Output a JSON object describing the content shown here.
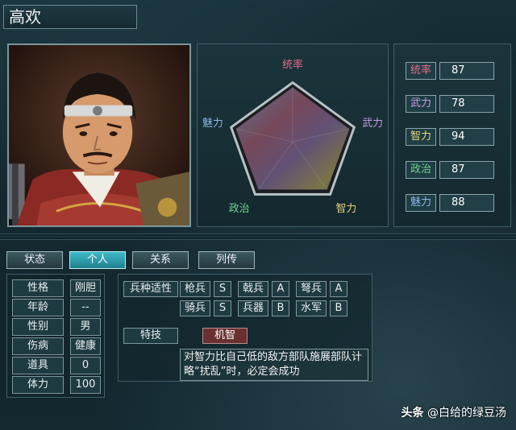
{
  "header": {
    "name": "高欢"
  },
  "radar": {
    "labels": {
      "command": "统率",
      "strength": "武力",
      "intelligence": "智力",
      "politics": "政治",
      "charm": "魅力"
    },
    "colors": {
      "command": "#e46b8a",
      "strength": "#c79ae8",
      "intelligence": "#e7d27a",
      "politics": "#6fd18c",
      "charm": "#8ab6e6"
    }
  },
  "stats": [
    {
      "label": "统率",
      "value": "87",
      "color": "#e46b8a"
    },
    {
      "label": "武力",
      "value": "78",
      "color": "#c79ae8"
    },
    {
      "label": "智力",
      "value": "94",
      "color": "#e7d27a"
    },
    {
      "label": "政治",
      "value": "87",
      "color": "#6fd18c"
    },
    {
      "label": "魅力",
      "value": "88",
      "color": "#8ab6e6"
    }
  ],
  "tabs": [
    {
      "label": "状态",
      "active": false
    },
    {
      "label": "个人",
      "active": true
    },
    {
      "label": "关系",
      "active": false
    },
    {
      "label": "列传",
      "active": false
    }
  ],
  "info": [
    {
      "label": "性格",
      "value": "刚胆"
    },
    {
      "label": "年龄",
      "value": "--"
    },
    {
      "label": "性别",
      "value": "男"
    },
    {
      "label": "伤病",
      "value": "健康"
    },
    {
      "label": "道具",
      "value": "0"
    },
    {
      "label": "体力",
      "value": "100"
    }
  ],
  "aptitude": {
    "title": "兵种适性",
    "spear": {
      "label": "枪兵",
      "grade": "S"
    },
    "halberd": {
      "label": "戟兵",
      "grade": "A"
    },
    "crossbow": {
      "label": "弩兵",
      "grade": "A"
    },
    "cavalry": {
      "label": "骑兵",
      "grade": "S"
    },
    "siege": {
      "label": "兵器",
      "grade": "B"
    },
    "navy": {
      "label": "水军",
      "grade": "B"
    }
  },
  "skill": {
    "title": "特技",
    "name": "机智",
    "description": "对智力比自己低的敌方部队施展部队计略“扰乱”时，必定会成功"
  },
  "watermark": {
    "logo": "头条",
    "handle": "@白给的绿豆汤"
  }
}
